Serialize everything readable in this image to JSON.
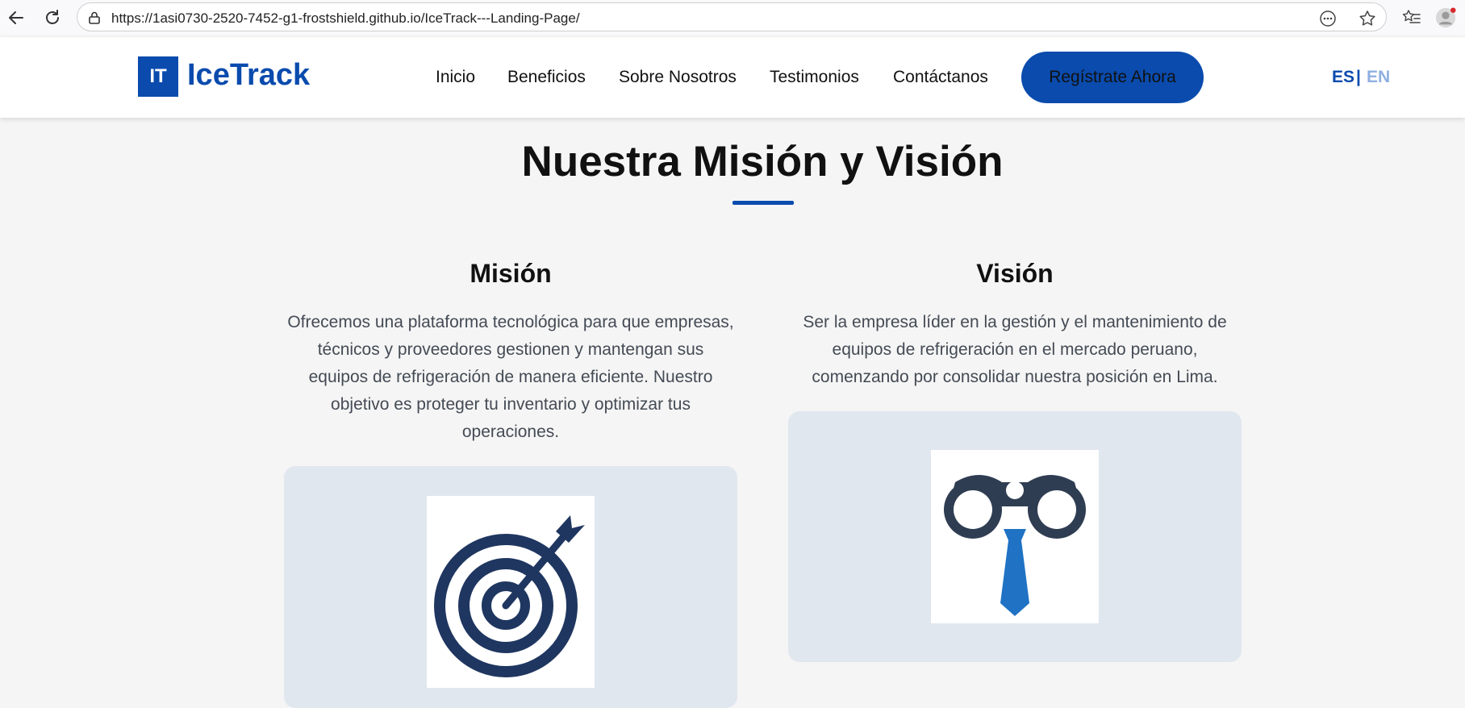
{
  "browser": {
    "url": "https://1asi0730-2520-7452-g1-frostshield.github.io/IceTrack---Landing-Page/"
  },
  "header": {
    "logo_badge": "IT",
    "logo_text": "IceTrack",
    "nav": [
      "Inicio",
      "Beneficios",
      "Sobre Nosotros",
      "Testimonios",
      "Contáctanos"
    ],
    "cta_label": "Regístrate Ahora",
    "lang_es": "ES",
    "lang_sep": "|",
    "lang_en": "EN"
  },
  "section": {
    "title": "Nuestra Misión y Visión",
    "mision": {
      "heading": "Misión",
      "lines": [
        "Ofrecemos una plataforma tecnológica para que empresas,",
        "técnicos y proveedores gestionen y mantengan sus",
        "equipos de refrigeración de manera eficiente. Nuestro",
        "objetivo es proteger tu inventario y optimizar tus",
        "operaciones."
      ]
    },
    "vision": {
      "heading": "Visión",
      "lines": [
        "Ser la empresa líder en la gestión y el mantenimiento de",
        "equipos de refrigeración en el mercado peruano,",
        "comenzando por consolidar nuestra posición en Lima."
      ]
    }
  },
  "colors": {
    "brand": "#0a4bad",
    "card_bg": "#e1e7ef",
    "icon_navy": "#1f3660",
    "tie_blue": "#1f72c4"
  },
  "icons": {
    "back": "back-arrow-icon",
    "reload": "reload-icon",
    "site_info": "site-info-icon",
    "more": "more-options-icon",
    "star": "favorite-star-icon",
    "favorites": "favorites-list-icon",
    "profile": "profile-avatar-icon",
    "target": "target-arrow-icon",
    "binoculars": "binoculars-tie-icon"
  }
}
